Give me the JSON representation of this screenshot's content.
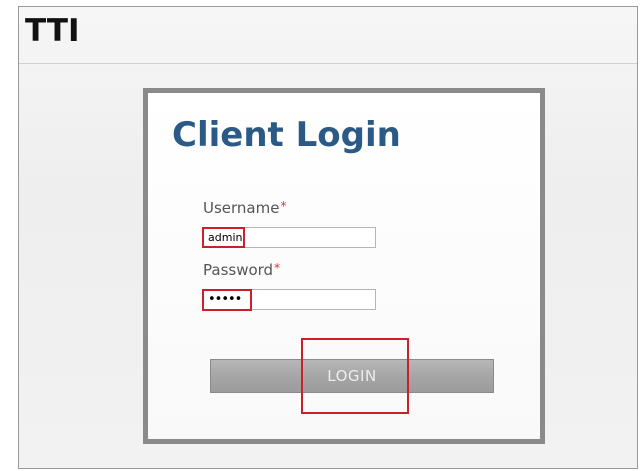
{
  "app": {
    "title": "TTI"
  },
  "login": {
    "title": "Client Login",
    "username_label": "Username",
    "password_label": "Password",
    "required_mark": "*",
    "username_value": "admin",
    "password_value": "•••••",
    "login_button": "LOGIN"
  },
  "colors": {
    "title_blue": "#2b5a86",
    "highlight_red": "#cc1f2a",
    "required_red": "#dd3333"
  }
}
